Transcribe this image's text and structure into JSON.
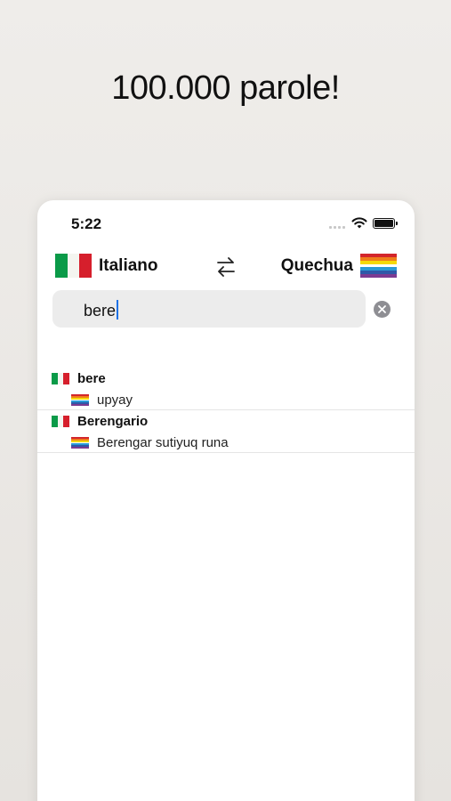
{
  "promo": {
    "title": "100.000 parole!"
  },
  "status_bar": {
    "time": "5:22"
  },
  "languages": {
    "source": {
      "label": "Italiano",
      "flag": "italy-flag-icon"
    },
    "target": {
      "label": "Quechua",
      "flag": "wiphala-flag-icon"
    }
  },
  "search": {
    "value": "bere"
  },
  "results": [
    {
      "word": "bere",
      "translation": "upyay"
    },
    {
      "word": "Berengario",
      "translation": "Berengar sutiyuq runa"
    }
  ],
  "colors": {
    "accent_caret": "#1f72e6",
    "background": "#efedea"
  }
}
